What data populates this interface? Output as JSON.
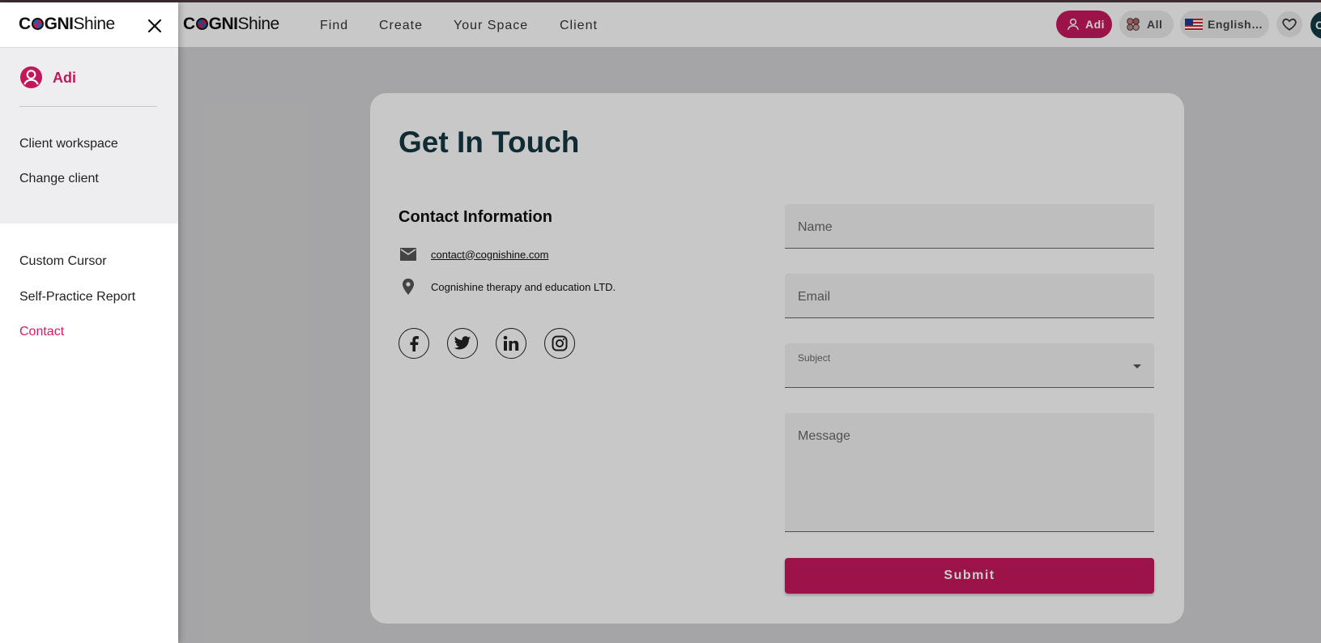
{
  "app": {
    "logo_prefix": "C",
    "logo_mid": "GNI",
    "logo_suffix": "Shine"
  },
  "topnav": {
    "items": [
      "Find",
      "Create",
      "Your Space",
      "Client"
    ]
  },
  "header_right": {
    "user_label": "Adi",
    "filter_label": "All",
    "language_label": "English…",
    "avatar_initial": "C"
  },
  "contact_page": {
    "title": "Get In Touch",
    "info_heading": "Contact Information",
    "email": "contact@cognishine.com",
    "address": "Cognishine therapy and education LTD.",
    "socials": [
      "facebook-icon",
      "twitter-icon",
      "linkedin-icon",
      "instagram-icon"
    ],
    "form": {
      "name_placeholder": "Name",
      "email_placeholder": "Email",
      "subject_label": "Subject",
      "message_placeholder": "Message",
      "submit_label": "Submit"
    }
  },
  "drawer": {
    "user_name": "Adi",
    "client_items": [
      "Client workspace",
      "Change client"
    ],
    "menu_items": [
      "Custom Cursor",
      "Self-Practice Report",
      "Contact"
    ],
    "active_item": "Contact"
  },
  "colors": {
    "accent": "#c2185b",
    "title": "#143642",
    "active_link": "#d81b60"
  }
}
